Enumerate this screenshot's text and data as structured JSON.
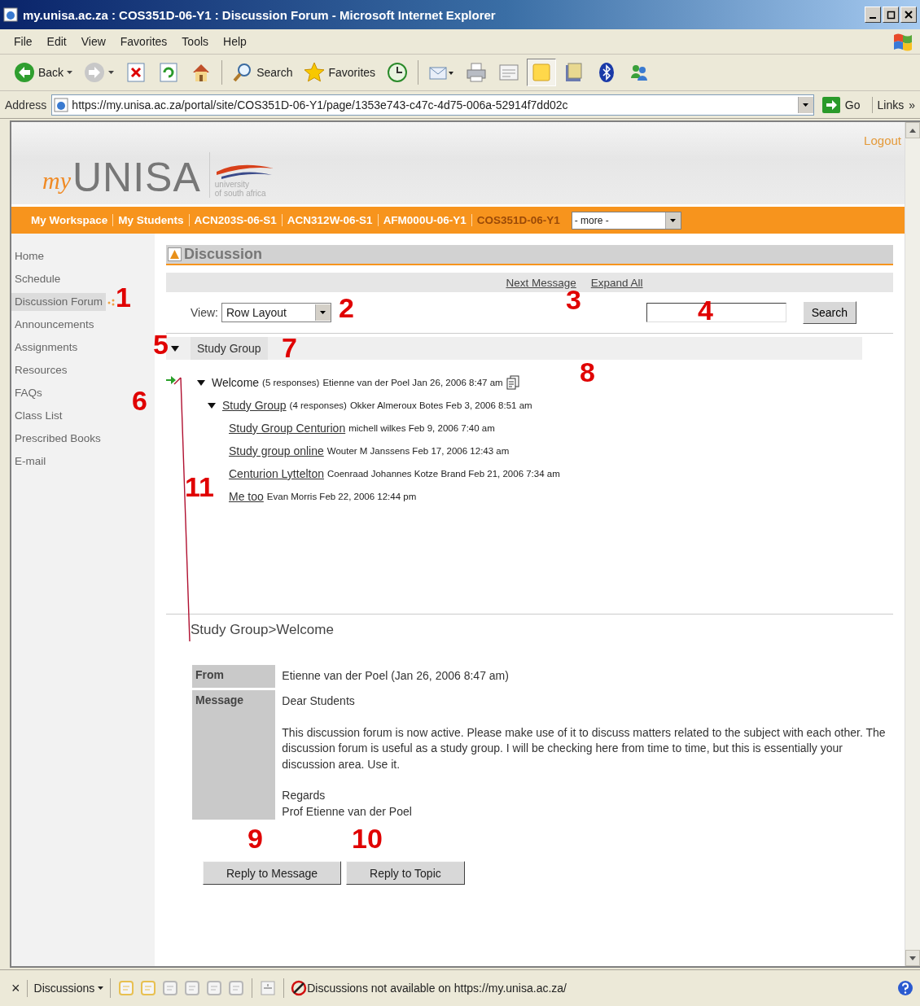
{
  "window": {
    "title": "my.unisa.ac.za : COS351D-06-Y1 : Discussion Forum - Microsoft Internet Explorer"
  },
  "menu": [
    "File",
    "Edit",
    "View",
    "Favorites",
    "Tools",
    "Help"
  ],
  "toolbar": [
    {
      "kind": "back",
      "label": "Back",
      "pressed": false
    },
    {
      "kind": "forward",
      "pressed": false
    },
    {
      "kind": "stop",
      "pressed": false
    },
    {
      "kind": "refresh",
      "pressed": false
    },
    {
      "kind": "home",
      "pressed": false
    },
    {
      "kind": "search",
      "label": "Search",
      "pressed": false
    },
    {
      "kind": "favorites",
      "label": "Favorites",
      "pressed": false
    },
    {
      "kind": "history",
      "pressed": false
    },
    {
      "kind": "mail",
      "pressed": false
    },
    {
      "kind": "print",
      "pressed": false
    },
    {
      "kind": "edit",
      "pressed": false
    },
    {
      "kind": "note",
      "pressed": true
    },
    {
      "kind": "research",
      "pressed": false
    },
    {
      "kind": "bluetooth",
      "pressed": false
    },
    {
      "kind": "messenger",
      "pressed": false
    }
  ],
  "address": {
    "label": "Address",
    "url": "https://my.unisa.ac.za/portal/site/COS351D-06-Y1/page/1353e743-c47c-4d75-006a-52914f7dd02c",
    "go": "Go",
    "links": "Links",
    "more": "»"
  },
  "site": {
    "logout": "Logout",
    "logo_prefix": "my",
    "logo_name": "UNISA",
    "tagline": [
      "university",
      "of south africa"
    ]
  },
  "nav": {
    "tabs": [
      {
        "label": "My Workspace",
        "selected": false
      },
      {
        "label": "My Students",
        "selected": false
      },
      {
        "label": "ACN203S-06-S1",
        "selected": false
      },
      {
        "label": "ACN312W-06-S1",
        "selected": false
      },
      {
        "label": "AFM000U-06-Y1",
        "selected": false
      },
      {
        "label": "COS351D-06-Y1",
        "selected": true
      }
    ],
    "more": "- more -"
  },
  "sidebar": {
    "items": [
      {
        "label": "Home",
        "selected": false
      },
      {
        "label": "Schedule",
        "selected": false
      },
      {
        "label": "Discussion Forum",
        "selected": true
      },
      {
        "label": "Announcements",
        "selected": false
      },
      {
        "label": "Assignments",
        "selected": false
      },
      {
        "label": "Resources",
        "selected": false
      },
      {
        "label": "FAQs",
        "selected": false
      },
      {
        "label": "Class List",
        "selected": false
      },
      {
        "label": "Prescribed Books",
        "selected": false
      },
      {
        "label": "E-mail",
        "selected": false
      }
    ]
  },
  "tool": {
    "title": "Discussion",
    "links": [
      "Next Message",
      "Expand All"
    ],
    "view_label": "View:",
    "view_value": "Row Layout",
    "search_button": "Search"
  },
  "topic": {
    "title": "Study Group",
    "expanded": true
  },
  "messages": [
    {
      "title": "Welcome",
      "responses": "(5 responses)",
      "byline": "Etienne van der Poel Jan 26, 2006 8:47 am",
      "selected": true,
      "expanded": true,
      "attachment": true,
      "children": [
        {
          "title": "Study Group",
          "responses": "(4 responses)",
          "byline": "Okker Almeroux Botes Feb 3, 2006 8:51 am",
          "selected": false,
          "expanded": true,
          "attachment": false,
          "children": [
            {
              "title": "Study Group Centurion",
              "byline": "michell wilkes Feb 9, 2006 7:40 am",
              "selected": false,
              "attachment": false
            },
            {
              "title": "Study group online",
              "byline": "Wouter M Janssens Feb 17, 2006 12:43 am",
              "selected": false,
              "attachment": false
            },
            {
              "title": "Centurion Lyttelton",
              "byline": "Coenraad Johannes Kotze Brand Feb 21, 2006 7:34 am",
              "selected": false,
              "attachment": false
            },
            {
              "title": "Me too",
              "byline": "Evan Morris Feb 22, 2006 12:44 pm",
              "selected": false,
              "attachment": false
            }
          ]
        }
      ]
    }
  ],
  "detail": {
    "breadcrumb": "Study Group>Welcome",
    "rows": [
      {
        "header": "From",
        "paragraphs": [
          [
            "Etienne van der Poel (Jan 26, 2006 8:47 am)"
          ]
        ]
      },
      {
        "header": "Message",
        "paragraphs": [
          [
            "Dear Students"
          ],
          [
            "This discussion forum is now active. Please make use of it to discuss matters related to the subject with each other. The discussion forum is useful as a study group. I will be checking here from time to time, but this is essentially your discussion area. Use it."
          ],
          [
            "Regards",
            "Prof Etienne van der Poel"
          ]
        ]
      }
    ]
  },
  "buttons": [
    "Reply to Message",
    "Reply to Topic"
  ],
  "status_bar": {
    "close": "×",
    "menu": "Discussions",
    "message": "Discussions not available on https://my.unisa.ac.za/"
  },
  "callouts": [
    {
      "label": "1"
    },
    {
      "label": "2"
    },
    {
      "label": "3"
    },
    {
      "label": "4"
    },
    {
      "label": "5"
    },
    {
      "label": "6"
    },
    {
      "label": "7"
    },
    {
      "label": "8"
    },
    {
      "label": "9"
    },
    {
      "label": "10"
    },
    {
      "label": "11"
    }
  ]
}
